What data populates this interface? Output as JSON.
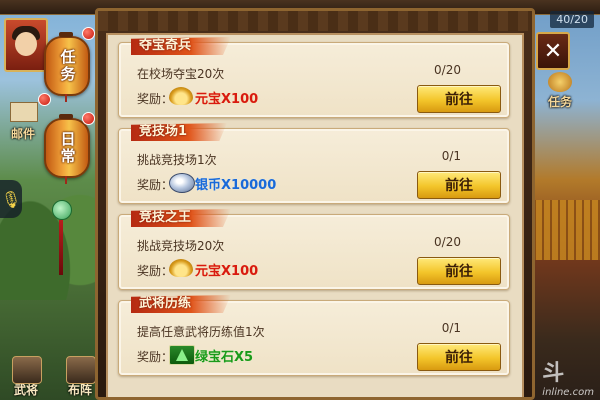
{
  "hud": {
    "counter": "40/20",
    "lantern_task": "任务",
    "lantern_daily": "日常",
    "mail": "邮件",
    "right_task": "任务",
    "close": "✕",
    "bottom_buttons": [
      "武将",
      "布阵"
    ],
    "watermark_line1": "斗",
    "watermark_line2": "inline.com"
  },
  "tasks": [
    {
      "title": "夺宝奇兵",
      "desc": "在校场夺宝20次",
      "reward_label": "奖励：",
      "reward_icon": "gold-ingot-icon",
      "reward_text": "元宝X100",
      "progress": "0/20",
      "button": "前往"
    },
    {
      "title": "竞技场1",
      "desc": "挑战竞技场1次",
      "reward_label": "奖励：",
      "reward_icon": "silver-coin-icon",
      "reward_text": "银币X10000",
      "progress": "0/1",
      "button": "前往"
    },
    {
      "title": "竞技之王",
      "desc": "挑战竞技场20次",
      "reward_label": "奖励：",
      "reward_icon": "gold-ingot-icon",
      "reward_text": "元宝X100",
      "progress": "0/20",
      "button": "前往"
    },
    {
      "title": "武将历练",
      "desc": "提高任意武将历练值1次",
      "reward_label": "奖励：",
      "reward_icon": "green-gem-icon",
      "reward_text": "绿宝石X5",
      "progress": "0/1",
      "button": "前往"
    }
  ],
  "colors": {
    "ribbon": "#d1401a",
    "button": "#f3c52a",
    "card": "#f3e8cf",
    "frame": "#8e6530"
  }
}
